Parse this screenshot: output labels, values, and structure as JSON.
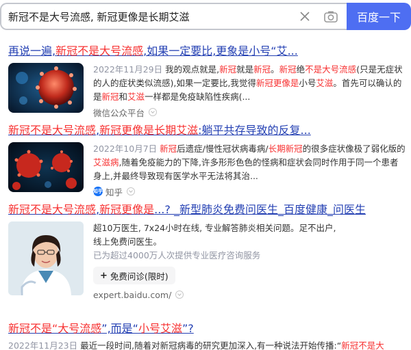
{
  "search": {
    "query": "新冠不是大号流感, 新冠更像是长期艾滋",
    "button_label": "百度一下"
  },
  "results": [
    {
      "title_parts": [
        {
          "text": "再说一遍,",
          "hl": false
        },
        {
          "text": "新冠不是大号流感",
          "hl": true
        },
        {
          "text": ",如果一定要比,更象是小号“艾...",
          "hl": false
        }
      ],
      "date": "2022年11月29日",
      "snippet_parts": [
        {
          "text": " 我的观点就是,",
          "hl": false
        },
        {
          "text": "新冠",
          "hl": true
        },
        {
          "text": "就是",
          "hl": false
        },
        {
          "text": "新冠",
          "hl": true
        },
        {
          "text": "。",
          "hl": false
        },
        {
          "text": "新冠",
          "hl": true
        },
        {
          "text": "绝",
          "hl": false
        },
        {
          "text": "不是大号流感",
          "hl": true
        },
        {
          "text": "(只是无症状的人的症状类似流感),如果一定要比,我觉得",
          "hl": false
        },
        {
          "text": "新冠更像是",
          "hl": true
        },
        {
          "text": "小号",
          "hl": false
        },
        {
          "text": "艾滋",
          "hl": true
        },
        {
          "text": "。首先可以确认的是",
          "hl": false
        },
        {
          "text": "新冠",
          "hl": true
        },
        {
          "text": "和",
          "hl": false
        },
        {
          "text": "艾滋",
          "hl": true
        },
        {
          "text": "一样都是免疫缺陷性疾病(...",
          "hl": false
        }
      ],
      "source": "微信公众平台"
    },
    {
      "title_parts": [
        {
          "text": "新冠不是大号流感",
          "hl": true
        },
        {
          "text": ",",
          "hl": false
        },
        {
          "text": "新冠更像是长期艾滋",
          "hl": true
        },
        {
          "text": ":躺平共存导致的反复...",
          "hl": false
        }
      ],
      "date": "2022年10月7日",
      "snippet_parts": [
        {
          "text": " ",
          "hl": false
        },
        {
          "text": "新冠",
          "hl": true
        },
        {
          "text": "后遗症/慢性冠状病毒病/",
          "hl": false
        },
        {
          "text": "长期新冠",
          "hl": true
        },
        {
          "text": "的很多症状像极了弱化版的",
          "hl": false
        },
        {
          "text": "艾滋病",
          "hl": true
        },
        {
          "text": ",随着免疫能力的下降,许多形形色色的怪病和症状会同时作用于同一个患者身上,并最终导致现有医学水平无法将其治...",
          "hl": false
        }
      ],
      "source": "知乎",
      "source_logo": "知乎"
    },
    {
      "title_parts": [
        {
          "text": "新冠不是大号流感",
          "hl": true
        },
        {
          "text": ",",
          "hl": false
        },
        {
          "text": "新冠更像是",
          "hl": true
        },
        {
          "text": "...? _新型肺炎免费问医生_百度健康_问医生",
          "hl": false
        }
      ],
      "line1": "超10万医生, 7x24小时在线, 专业解答肺炎相关问题。足不出户,",
      "line2": "线上免费问医生。",
      "stat": "已为超过4000万人次提供专业医疗咨询服务",
      "consult_label": "免费问诊(限时)",
      "source": "expert.baidu.com/"
    },
    {
      "title_parts": [
        {
          "text": "新冠不是“大号流感",
          "hl": true
        },
        {
          "text": "”,而是“",
          "hl": false
        },
        {
          "text": "小号艾滋",
          "hl": true
        },
        {
          "text": "”?",
          "hl": false
        }
      ],
      "date": "2022年11月23日",
      "snippet_parts": [
        {
          "text": " 最近一段时间,随着对新冠病毒的研究更加深入,有一种说法开始传播:“",
          "hl": false
        },
        {
          "text": "新冠不是大",
          "hl": true
        }
      ]
    }
  ],
  "colors": {
    "link": "#2440b3",
    "highlight": "#f73131",
    "button": "#4e6ef2"
  },
  "icons": [
    "clear-icon",
    "camera-icon",
    "verified-icon",
    "plus-icon"
  ]
}
